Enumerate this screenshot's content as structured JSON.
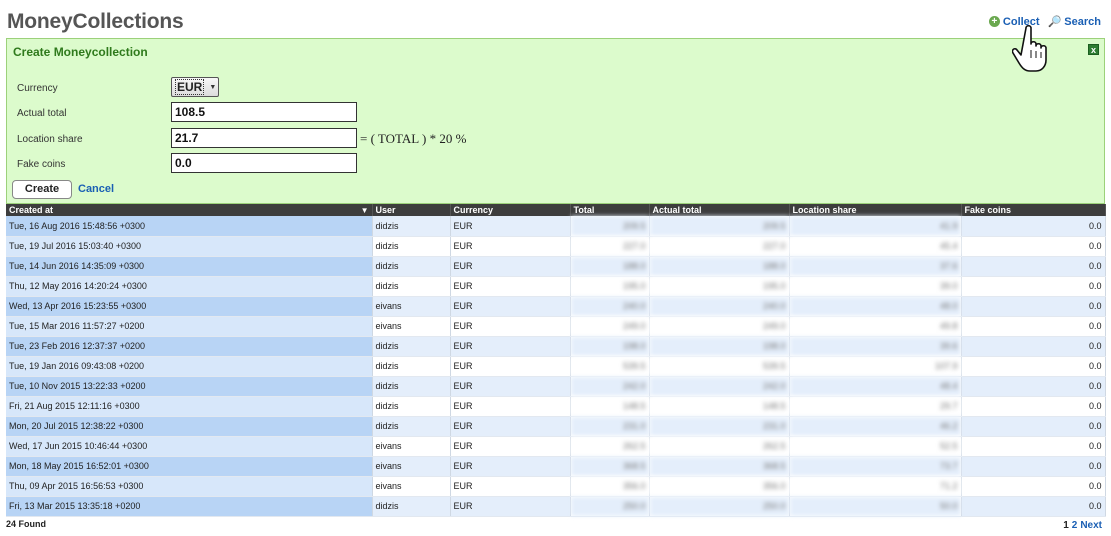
{
  "page": {
    "title": "MoneyCollections"
  },
  "top_actions": {
    "collect": "Collect",
    "search": "Search"
  },
  "form": {
    "title": "Create Moneycollection",
    "close": "x",
    "currency_label": "Currency",
    "currency_value": "EUR",
    "actual_total_label": "Actual total",
    "actual_total_value": "108.5",
    "location_share_label": "Location share",
    "location_share_value": "21.7",
    "formula": "= ( TOTAL ) * 20 %",
    "fake_coins_label": "Fake coins",
    "fake_coins_value": "0.0",
    "create": "Create",
    "cancel": "Cancel"
  },
  "table": {
    "columns": [
      "Created at",
      "User",
      "Currency",
      "Total",
      "Actual total",
      "Location share",
      "Fake coins"
    ],
    "rows": [
      [
        "Tue, 16 Aug 2016 15:48:56 +0300",
        "didzis",
        "EUR",
        "209.5",
        "209.5",
        "41.9",
        "0.0"
      ],
      [
        "Tue, 19 Jul 2016 15:03:40 +0300",
        "didzis",
        "EUR",
        "227.0",
        "227.0",
        "45.4",
        "0.0"
      ],
      [
        "Tue, 14 Jun 2016 14:35:09 +0300",
        "didzis",
        "EUR",
        "188.0",
        "188.0",
        "37.6",
        "0.0"
      ],
      [
        "Thu, 12 May 2016 14:20:24 +0300",
        "didzis",
        "EUR",
        "195.0",
        "195.0",
        "39.0",
        "0.0"
      ],
      [
        "Wed, 13 Apr 2016 15:23:55 +0300",
        "eivans",
        "EUR",
        "240.0",
        "240.0",
        "48.0",
        "0.0"
      ],
      [
        "Tue, 15 Mar 2016 11:57:27 +0200",
        "eivans",
        "EUR",
        "249.0",
        "249.0",
        "49.8",
        "0.0"
      ],
      [
        "Tue, 23 Feb 2016 12:37:37 +0200",
        "didzis",
        "EUR",
        "198.0",
        "198.0",
        "39.6",
        "0.0"
      ],
      [
        "Tue, 19 Jan 2016 09:43:08 +0200",
        "didzis",
        "EUR",
        "539.5",
        "539.5",
        "107.9",
        "0.0"
      ],
      [
        "Tue, 10 Nov 2015 13:22:33 +0200",
        "didzis",
        "EUR",
        "242.0",
        "242.0",
        "48.4",
        "0.0"
      ],
      [
        "Fri, 21 Aug 2015 12:11:16 +0300",
        "didzis",
        "EUR",
        "148.5",
        "148.5",
        "29.7",
        "0.0"
      ],
      [
        "Mon, 20 Jul 2015 12:38:22 +0300",
        "didzis",
        "EUR",
        "231.0",
        "231.0",
        "46.2",
        "0.0"
      ],
      [
        "Wed, 17 Jun 2015 10:46:44 +0300",
        "eivans",
        "EUR",
        "262.5",
        "262.5",
        "52.5",
        "0.0"
      ],
      [
        "Mon, 18 May 2015 16:52:01 +0300",
        "eivans",
        "EUR",
        "368.5",
        "368.5",
        "73.7",
        "0.0"
      ],
      [
        "Thu, 09 Apr 2015 16:56:53 +0300",
        "eivans",
        "EUR",
        "356.0",
        "356.0",
        "71.2",
        "0.0"
      ],
      [
        "Fri, 13 Mar 2015 13:35:18 +0200",
        "didzis",
        "EUR",
        "250.0",
        "250.0",
        "50.0",
        "0.0"
      ]
    ]
  },
  "footer": {
    "found": "24 Found",
    "page_1": "1",
    "page_2": "2",
    "next": "Next"
  }
}
